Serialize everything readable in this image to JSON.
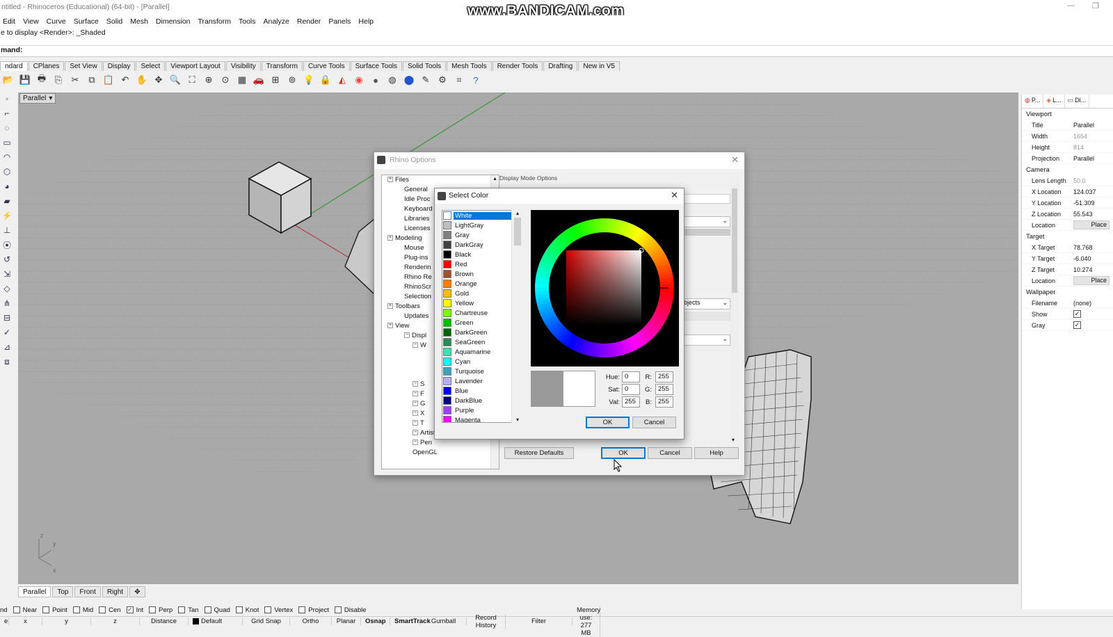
{
  "app": {
    "title": "ntitled - Rhinoceros (Educational) (64-bit) - [Parallel]",
    "watermark": "www.BANDICAM.com"
  },
  "menubar": [
    "Edit",
    "View",
    "Curve",
    "Surface",
    "Solid",
    "Mesh",
    "Dimension",
    "Transform",
    "Tools",
    "Analyze",
    "Render",
    "Panels",
    "Help"
  ],
  "command": {
    "history": "e to display <Render>: _Shaded",
    "prompt": "mand:"
  },
  "toolbar_tabs": [
    "ndard",
    "CPlanes",
    "Set View",
    "Display",
    "Select",
    "Viewport Layout",
    "Visibility",
    "Transform",
    "Curve Tools",
    "Surface Tools",
    "Solid Tools",
    "Mesh Tools",
    "Render Tools",
    "Drafting",
    "New in V5"
  ],
  "toolbar_icons": [
    "open-icon",
    "save-icon",
    "print-icon",
    "import-icon",
    "cut-icon",
    "copy-icon",
    "paste-icon",
    "undo-icon",
    "pan-icon",
    "rotate-view-icon",
    "zoom-icon",
    "zoom-extents-icon",
    "zoom-window-icon",
    "zoom-selected-icon",
    "four-view-icon",
    "car-icon",
    "ortho-icon",
    "object-snap-icon",
    "light-icon",
    "lock-icon",
    "material-icon",
    "color-icon",
    "shaded-icon",
    "render-icon",
    "rendered-icon",
    "brush-icon",
    "settings-icon",
    "grid-icon",
    "help-icon"
  ],
  "viewport": {
    "label": "Parallel",
    "axis_y": "y",
    "axis_x": "x",
    "axis_z": "z"
  },
  "viewport_tabs": [
    "Parallel",
    "Top",
    "Front",
    "Right"
  ],
  "right_panel": {
    "tabs": [
      "P...",
      "L...",
      "Di..."
    ],
    "sections": [
      {
        "title": "Viewport",
        "rows": [
          {
            "k": "Title",
            "v": "Parallel",
            "dim": false
          },
          {
            "k": "Width",
            "v": "1654",
            "dim": true
          },
          {
            "k": "Height",
            "v": "814",
            "dim": true
          },
          {
            "k": "Projection",
            "v": "Parallel",
            "dim": false
          }
        ]
      },
      {
        "title": "Camera",
        "rows": [
          {
            "k": "Lens Length",
            "v": "50.0",
            "dim": true
          },
          {
            "k": "X Location",
            "v": "124.037",
            "dim": false
          },
          {
            "k": "Y Location",
            "v": "-51.309",
            "dim": false
          },
          {
            "k": "Z Location",
            "v": "55.543",
            "dim": false
          },
          {
            "k": "Location",
            "v": "Place",
            "btn": true
          }
        ]
      },
      {
        "title": "Target",
        "rows": [
          {
            "k": "X Target",
            "v": "78.768",
            "dim": false
          },
          {
            "k": "Y Target",
            "v": "-6.040",
            "dim": false
          },
          {
            "k": "Z Target",
            "v": "10.274",
            "dim": false
          },
          {
            "k": "Location",
            "v": "Place",
            "btn": true
          }
        ]
      },
      {
        "title": "Wallpaper",
        "rows": [
          {
            "k": "Filename",
            "v": "(none)",
            "dim": false
          },
          {
            "k": "Show",
            "v": "✓",
            "chk": true
          },
          {
            "k": "Gray",
            "v": "✓",
            "chk": true
          }
        ]
      }
    ]
  },
  "osnaps": [
    {
      "label": "nd",
      "checked": false,
      "nobox": true
    },
    {
      "label": "Near",
      "checked": false
    },
    {
      "label": "Point",
      "checked": false
    },
    {
      "label": "Mid",
      "checked": false
    },
    {
      "label": "Cen",
      "checked": false
    },
    {
      "label": "Int",
      "checked": true
    },
    {
      "label": "Perp",
      "checked": false
    },
    {
      "label": "Tan",
      "checked": false
    },
    {
      "label": "Quad",
      "checked": false
    },
    {
      "label": "Knot",
      "checked": false
    },
    {
      "label": "Vertex",
      "checked": false
    },
    {
      "label": "Project",
      "checked": false
    },
    {
      "label": "Disable",
      "checked": false
    }
  ],
  "statusbar": {
    "items": [
      "x",
      "y",
      "z",
      "Distance",
      "Default",
      "Grid Snap",
      "Ortho",
      "Planar",
      "Osnap",
      "SmartTrack",
      "Gumball",
      "Record History",
      "Filter",
      "Memory use: 277 MB"
    ],
    "first": "e"
  },
  "rhino_options": {
    "title": "Rhino Options",
    "tree": [
      {
        "label": "Files",
        "indent": 0,
        "plus": true
      },
      {
        "label": "General",
        "indent": 1
      },
      {
        "label": "Idle Proc",
        "indent": 1
      },
      {
        "label": "Keyboard",
        "indent": 1
      },
      {
        "label": "Libraries",
        "indent": 1
      },
      {
        "label": "Licenses",
        "indent": 1
      },
      {
        "label": "Modeling",
        "indent": 0,
        "plus": true
      },
      {
        "label": "Mouse",
        "indent": 1
      },
      {
        "label": "Plug-ins",
        "indent": 1
      },
      {
        "label": "Renderin",
        "indent": 1
      },
      {
        "label": "Rhino Re",
        "indent": 1
      },
      {
        "label": "RhinoScr",
        "indent": 1
      },
      {
        "label": "Selection",
        "indent": 1
      },
      {
        "label": "Toolbars",
        "indent": 0,
        "plus": true
      },
      {
        "label": "Updates",
        "indent": 1
      },
      {
        "label": "View",
        "indent": 0,
        "plus": true
      },
      {
        "label": "Displ",
        "indent": 2,
        "plus": true
      },
      {
        "label": "W",
        "indent": 3,
        "plus": true
      },
      {
        "label": "",
        "indent": 4
      },
      {
        "label": "",
        "indent": 4
      },
      {
        "label": "",
        "indent": 4
      },
      {
        "label": "S",
        "indent": 3,
        "plus": true
      },
      {
        "label": "F",
        "indent": 3,
        "plus": true
      },
      {
        "label": "G",
        "indent": 3,
        "plus": true
      },
      {
        "label": "X",
        "indent": 3,
        "plus": true
      },
      {
        "label": "T",
        "indent": 3,
        "plus": true
      },
      {
        "label": "Artistic",
        "indent": 3,
        "plus": true
      },
      {
        "label": "Pen",
        "indent": 3,
        "plus": true
      },
      {
        "label": "OpenGL",
        "indent": 2
      }
    ],
    "section_heading": "Display Mode Options",
    "objects_label": "bjects",
    "restore_defaults": "Restore Defaults",
    "ok": "OK",
    "cancel": "Cancel",
    "help": "Help"
  },
  "select_color": {
    "title": "Select Color",
    "colors": [
      {
        "name": "White",
        "hex": "#ffffff"
      },
      {
        "name": "LightGray",
        "hex": "#c0c0c0"
      },
      {
        "name": "Gray",
        "hex": "#808080"
      },
      {
        "name": "DarkGray",
        "hex": "#404040"
      },
      {
        "name": "Black",
        "hex": "#000000"
      },
      {
        "name": "Red",
        "hex": "#ff0000"
      },
      {
        "name": "Brown",
        "hex": "#a0522d"
      },
      {
        "name": "Orange",
        "hex": "#ff8000"
      },
      {
        "name": "Gold",
        "hex": "#ffbf00"
      },
      {
        "name": "Yellow",
        "hex": "#ffff00"
      },
      {
        "name": "Chartreuse",
        "hex": "#80ff00"
      },
      {
        "name": "Green",
        "hex": "#00c000"
      },
      {
        "name": "DarkGreen",
        "hex": "#006400"
      },
      {
        "name": "SeaGreen",
        "hex": "#2e8b57"
      },
      {
        "name": "Aquamarine",
        "hex": "#40e0b0"
      },
      {
        "name": "Cyan",
        "hex": "#00ffff"
      },
      {
        "name": "Turquoise",
        "hex": "#40a0c0"
      },
      {
        "name": "Lavender",
        "hex": "#b0b0ff"
      },
      {
        "name": "Blue",
        "hex": "#0000ff"
      },
      {
        "name": "DarkBlue",
        "hex": "#000080"
      },
      {
        "name": "Purple",
        "hex": "#a040ff"
      },
      {
        "name": "Magenta",
        "hex": "#ff00ff"
      }
    ],
    "selected": "White",
    "hue_label": "Hue:",
    "hue": "0",
    "sat_label": "Sat:",
    "sat": "0",
    "val_label": "Val:",
    "val": "255",
    "r_label": "R:",
    "r": "255",
    "g_label": "G:",
    "g": "255",
    "b_label": "B:",
    "b": "255",
    "ok": "OK",
    "cancel": "Cancel",
    "old_swatch": "#9a9a9a",
    "new_swatch": "#ffffff"
  }
}
